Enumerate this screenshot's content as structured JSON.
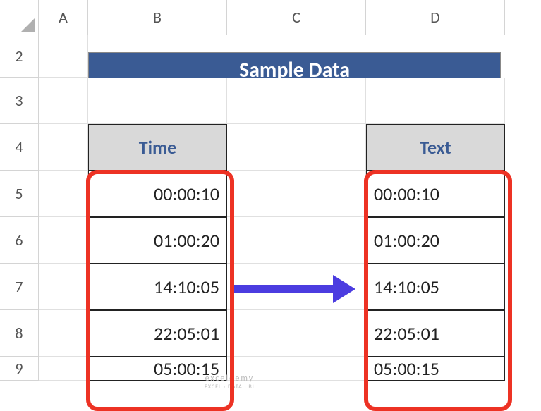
{
  "columns": {
    "A": "A",
    "B": "B",
    "C": "C",
    "D": "D"
  },
  "rows": {
    "r2": "2",
    "r3": "3",
    "r4": "4",
    "r5": "5",
    "r6": "6",
    "r7": "7",
    "r8": "8",
    "r9": "9"
  },
  "banner": {
    "title": "Sample Data"
  },
  "headers": {
    "time": "Time",
    "text": "Text"
  },
  "time_data": [
    "00:00:10",
    "01:00:20",
    "14:10:05",
    "22:05:01",
    "05:00:15"
  ],
  "text_data": [
    "00:00:10",
    "01:00:20",
    "14:10:05",
    "22:05:01",
    "05:00:15"
  ],
  "colors": {
    "banner_bg": "#3a5b94",
    "highlight": "#ed3224",
    "arrow": "#4b3ce0",
    "header_bg": "#d9d9d9"
  },
  "watermark": {
    "main": "exceldemy",
    "sub": "EXCEL · DATA · BI"
  },
  "chart_data": {
    "type": "table",
    "title": "Sample Data",
    "columns": [
      "Time",
      "Text"
    ],
    "rows": [
      [
        "00:00:10",
        "00:00:10"
      ],
      [
        "01:00:20",
        "01:00:20"
      ],
      [
        "14:10:05",
        "14:10:05"
      ],
      [
        "22:05:01",
        "22:05:01"
      ],
      [
        "05:00:15",
        "05:00:15"
      ]
    ]
  }
}
